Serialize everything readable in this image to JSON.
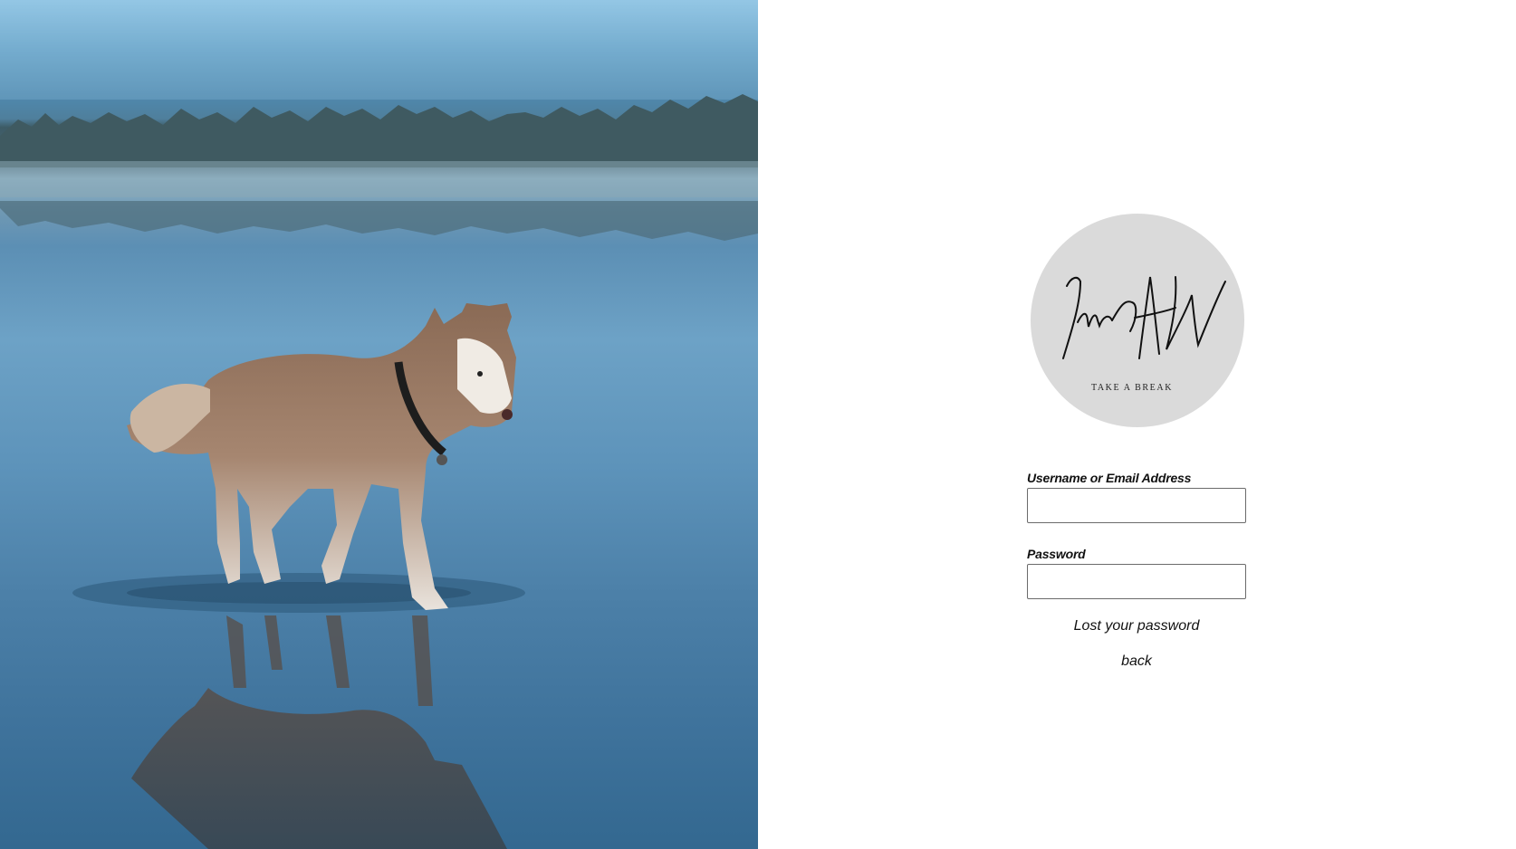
{
  "hero": {
    "image": "husky-walking-on-lake-photo"
  },
  "logo": {
    "signature": "ImAW",
    "tagline": "TAKE A BREAK"
  },
  "form": {
    "username_label": "Username or Email Address",
    "username_value": "",
    "password_label": "Password",
    "password_value": ""
  },
  "links": {
    "lost_password": "Lost your password",
    "back": "back"
  },
  "colors": {
    "logo_background": "#dadada",
    "input_border": "#6b6b6b",
    "text": "#111111"
  }
}
